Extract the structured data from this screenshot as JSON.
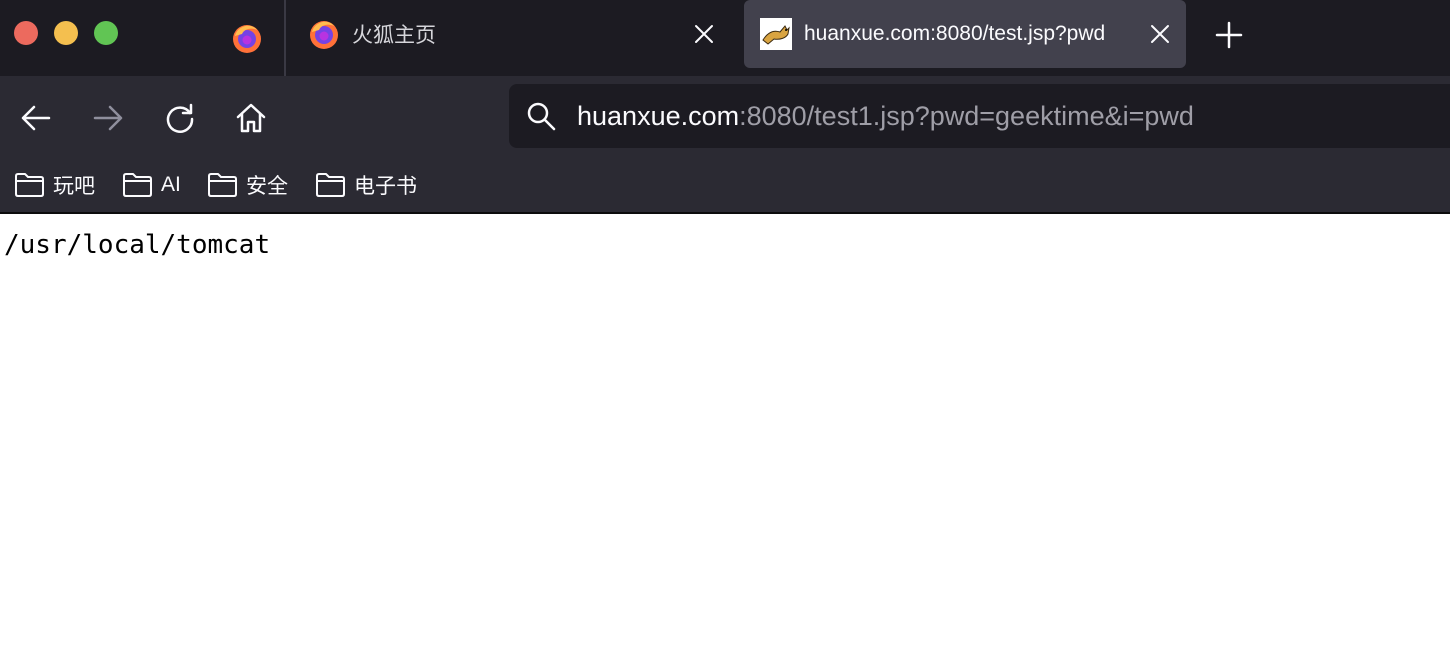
{
  "window": {
    "tabs": [
      {
        "title": "火狐主页",
        "icon": "firefox-icon",
        "active": false
      },
      {
        "title": "huanxue.com:8080/test.jsp?pwd",
        "icon": "tomcat-favicon-icon",
        "active": true
      }
    ]
  },
  "urlbar": {
    "host": "huanxue.com",
    "rest": ":8080/test1.jsp?pwd=geektime&i=pwd"
  },
  "bookmarks": [
    {
      "label": "玩吧"
    },
    {
      "label": "AI"
    },
    {
      "label": "安全"
    },
    {
      "label": "电子书"
    }
  ],
  "page": {
    "body_text": "/usr/local/tomcat"
  },
  "colors": {
    "titlebar": "#1c1b22",
    "toolbar": "#2b2a33",
    "active_tab": "#42414d",
    "url_rest": "#9f9ea7"
  }
}
